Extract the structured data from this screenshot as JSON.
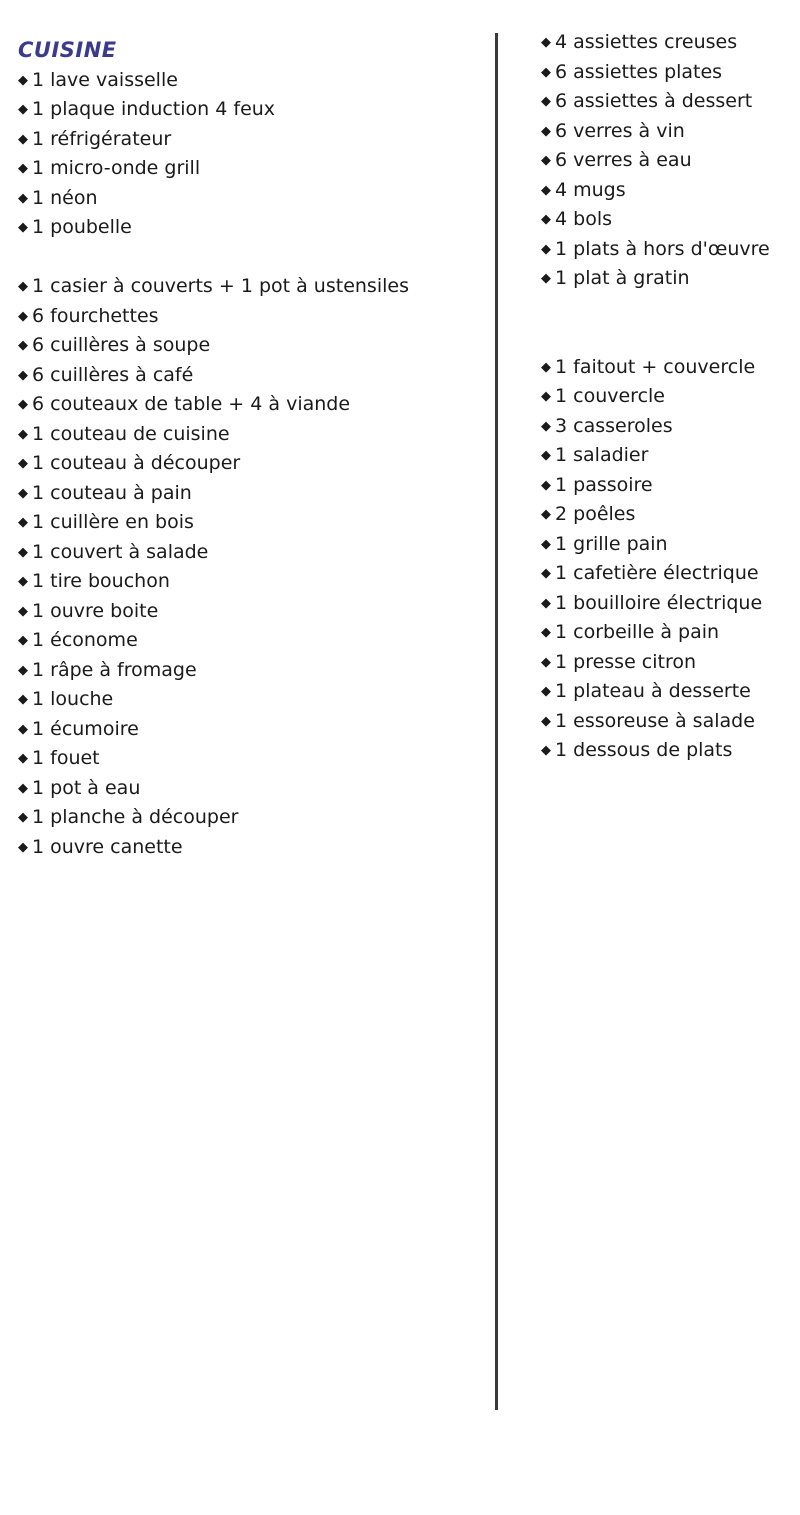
{
  "document": {
    "title": "CUISINE",
    "bullet_glyph": "◆",
    "title_color": "#3b3b8c",
    "text_color": "#1a1a1a",
    "divider_color": "#3a3a3c",
    "background_color": "#ffffff"
  },
  "left_column": {
    "groups": [
      {
        "items": [
          "1 lave vaisselle",
          "1 plaque induction 4 feux",
          "1 réfrigérateur",
          "1 micro-onde grill",
          "1 néon",
          "1 poubelle"
        ]
      },
      {
        "items": [
          "1 casier à couverts + 1 pot à ustensiles",
          "6 fourchettes",
          "6 cuillères à soupe",
          "6 cuillères à café",
          "6 couteaux de table + 4 à viande",
          "1 couteau de cuisine",
          "1 couteau à découper",
          "1 couteau à pain",
          "1 cuillère en bois",
          "1 couvert à salade",
          "1 tire bouchon",
          "1 ouvre boite",
          "1 économe",
          "1 râpe à fromage",
          "1 louche",
          "1 écumoire",
          "1 fouet",
          "1 pot à eau",
          "1 planche à découper",
          "1 ouvre canette"
        ]
      }
    ]
  },
  "right_column": {
    "groups": [
      {
        "items": [
          "4 assiettes creuses",
          "6 assiettes plates",
          "6 assiettes à dessert",
          "6 verres à vin",
          "6 verres à eau",
          "4 mugs",
          "4 bols",
          "1 plats à hors d'œuvre",
          "1 plat à gratin"
        ]
      },
      {
        "items": [
          "1 faitout + couvercle",
          "1 couvercle",
          "3 casseroles",
          "1 saladier",
          "1 passoire",
          "2 poêles",
          "1 grille pain",
          "1 cafetière électrique",
          "1 bouilloire électrique",
          "1 corbeille à pain",
          "1 presse citron",
          "1 plateau à desserte",
          "1 essoreuse à salade",
          "1 dessous de plats"
        ]
      }
    ]
  }
}
